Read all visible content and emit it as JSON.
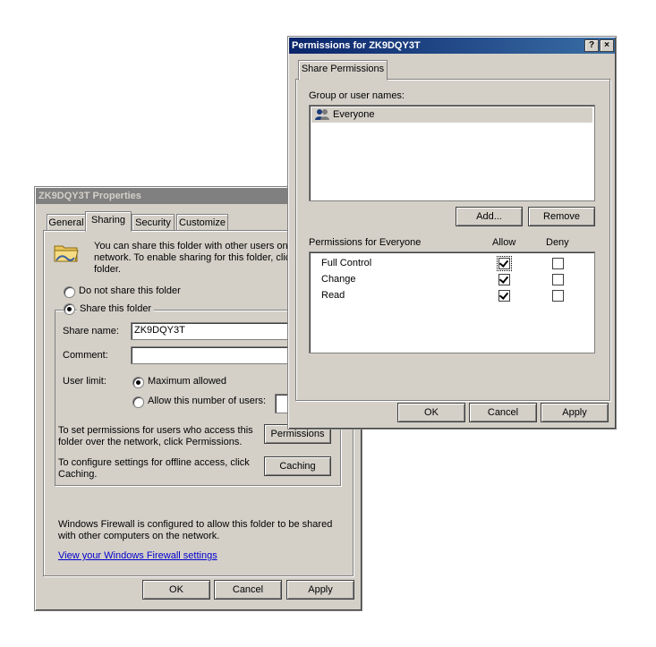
{
  "properties": {
    "title": "ZK9DQY3T Properties",
    "tabs": [
      "General",
      "Sharing",
      "Security",
      "Customize"
    ],
    "info_text": "You can share this folder with other users on y network.  To enable sharing for this folder, clic folder.",
    "no_share_label": "Do not share this folder",
    "share_label": "Share this folder",
    "share_name_label": "Share name:",
    "share_name_value": "ZK9DQY3T",
    "comment_label": "Comment:",
    "comment_value": "",
    "user_limit_label": "User limit:",
    "max_allowed_label": "Maximum allowed",
    "allow_number_label": "Allow this number of users:",
    "perm_text": "To set permissions for users who access this folder over the network, click Permissions.",
    "perm_button": "Permissions",
    "caching_text": "To configure settings for offline access, click Caching.",
    "caching_button": "Caching",
    "firewall_text": "Windows Firewall is configured to allow this folder to be shared with other computers on the network.",
    "firewall_link": "View your Windows Firewall settings",
    "ok": "OK",
    "cancel": "Cancel",
    "apply": "Apply"
  },
  "permissions": {
    "title": "Permissions for ZK9DQY3T",
    "help_btn": "?",
    "close_btn": "×",
    "tab": "Share Permissions",
    "group_label": "Group or user names:",
    "users": [
      "Everyone"
    ],
    "add_button": "Add...",
    "remove_button": "Remove",
    "perm_header": "Permissions for Everyone",
    "allow_header": "Allow",
    "deny_header": "Deny",
    "rows": [
      {
        "name": "Full Control",
        "allow": true,
        "deny": false
      },
      {
        "name": "Change",
        "allow": true,
        "deny": false
      },
      {
        "name": "Read",
        "allow": true,
        "deny": false
      }
    ],
    "ok": "OK",
    "cancel": "Cancel",
    "apply": "Apply"
  }
}
